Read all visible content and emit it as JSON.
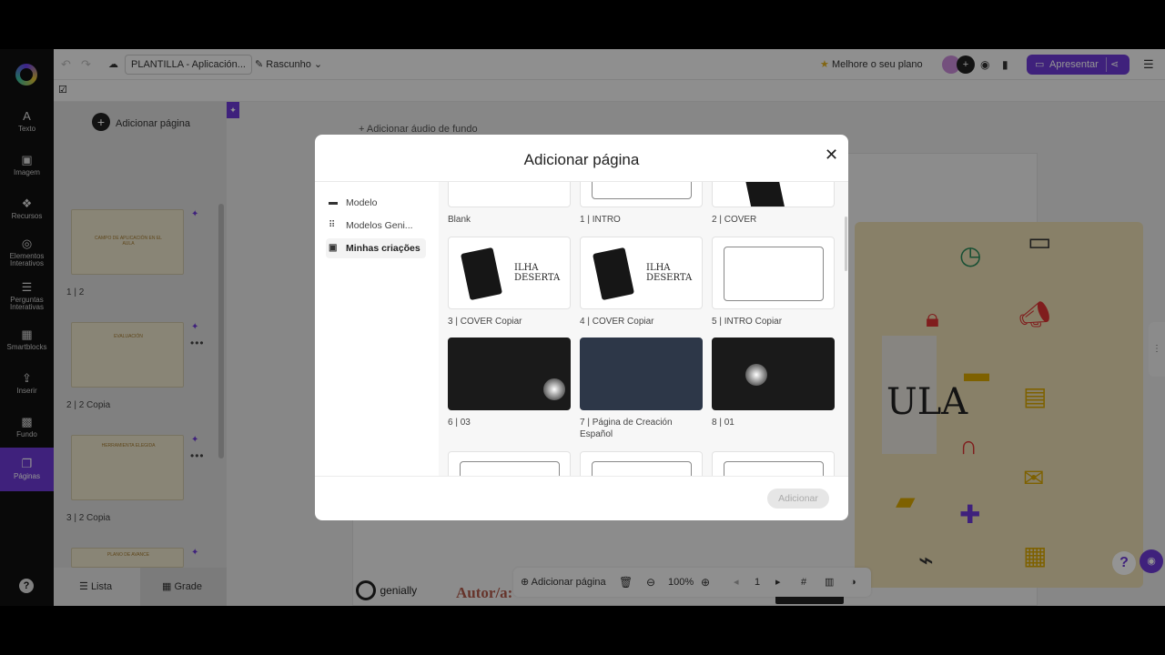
{
  "topbar": {
    "title": "PLANTILLA - Aplicación...",
    "draft_label": "Rascunho",
    "upgrade_label": "Melhore o seu plano",
    "present_label": "Apresentar"
  },
  "rail": {
    "items": [
      {
        "label": "Texto",
        "icon": "A"
      },
      {
        "label": "Imagem",
        "icon": "▣"
      },
      {
        "label": "Recursos",
        "icon": "❖"
      },
      {
        "label": "Elementos Interativos",
        "icon": "◎"
      },
      {
        "label": "Perguntas Interativas",
        "icon": "☰"
      },
      {
        "label": "Smartblocks",
        "icon": "▦"
      },
      {
        "label": "Inserir",
        "icon": "⇪"
      },
      {
        "label": "Fundo",
        "icon": "▩"
      },
      {
        "label": "Páginas",
        "icon": "❐"
      }
    ],
    "help": "?"
  },
  "panel": {
    "add_page_label": "Adicionar página",
    "pages": [
      {
        "label": "1 |  2",
        "thumb_text": "CAMPO DE APLICACIÓN EN EL AULA"
      },
      {
        "label": "2 |  2 Copia",
        "thumb_text": "EVALUACIÓN"
      },
      {
        "label": "3 |  2 Copia",
        "thumb_text": "HERRAMIENTA ELEGIDA"
      },
      {
        "label": "",
        "thumb_text": "PLANO DE AVANCE"
      }
    ],
    "view_list": "Lista",
    "view_grid": "Grade"
  },
  "canvas": {
    "audio_label": "Adicionar áudio de fundo",
    "author_label": "Autor/a:",
    "big_text": "ULA",
    "logo_text": "genially"
  },
  "bottombar": {
    "add_page_label": "Adicionar página",
    "zoom": "100%",
    "page_number": "1"
  },
  "modal": {
    "title": "Adicionar página",
    "nav": [
      {
        "label": "Modelo",
        "icon": "▬"
      },
      {
        "label": "Modelos Geni...",
        "icon": "⠿"
      },
      {
        "label": "Minhas criações",
        "icon": "▣"
      }
    ],
    "cards": [
      {
        "caption": "Blank",
        "style": "blank"
      },
      {
        "caption": "1 | INTRO",
        "style": "sketch"
      },
      {
        "caption": "2 | COVER",
        "style": "sketch"
      },
      {
        "caption": "3 | COVER Copiar",
        "style": "book"
      },
      {
        "caption": "4 | COVER Copiar",
        "style": "book"
      },
      {
        "caption": "5 | INTRO Copiar",
        "style": "sketch"
      },
      {
        "caption": "6 | 03",
        "style": "dark"
      },
      {
        "caption": "7 | Página de Creación Español",
        "style": "navy"
      },
      {
        "caption": "8 | 01",
        "style": "dark"
      },
      {
        "caption": "",
        "style": "sketch"
      },
      {
        "caption": "",
        "style": "sketch"
      },
      {
        "caption": "",
        "style": "sketch"
      }
    ],
    "book_text": "ILHA DESERTA",
    "add_button": "Adicionar"
  }
}
